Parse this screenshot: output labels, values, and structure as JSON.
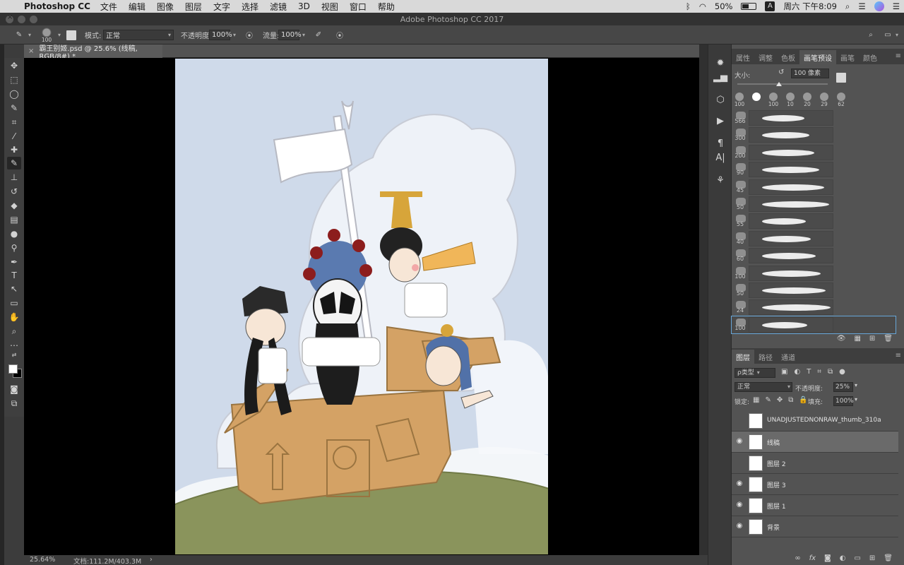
{
  "menubar": {
    "app": "Photoshop CC",
    "items": [
      "文件",
      "编辑",
      "图像",
      "图层",
      "文字",
      "选择",
      "滤镜",
      "3D",
      "视图",
      "窗口",
      "帮助"
    ],
    "battery": "50%",
    "input_source": "A",
    "clock": "周六 下午8:09"
  },
  "window": {
    "title": "Adobe Photoshop CC 2017"
  },
  "options_bar": {
    "brush_size": "100",
    "mode_label": "模式:",
    "mode_value": "正常",
    "opacity_label": "不透明度:",
    "opacity_value": "100%",
    "flow_label": "流量:",
    "flow_value": "100%"
  },
  "document_tab": {
    "title": "霸王别姬.psd @ 25.6% (线稿, RGB/8#) *"
  },
  "status_bar": {
    "zoom": "25.64%",
    "doc_size": "文档:111.2M/403.3M"
  },
  "brush_panel": {
    "tabs": [
      "属性",
      "调整",
      "色板",
      "画笔预设",
      "画笔",
      "颜色"
    ],
    "active_tab": "画笔预设",
    "size_label": "大小:",
    "size_value": "100 像素",
    "slider_fraction": 0.46,
    "top_presets": [
      "100",
      "",
      "100",
      "10",
      "20",
      "29",
      "62"
    ],
    "presets": [
      "566",
      "300",
      "200",
      "90",
      "45",
      "50",
      "55",
      "40",
      "60",
      "100",
      "50",
      "24",
      "100"
    ],
    "selected_index": 12
  },
  "layers_panel": {
    "tabs": [
      "图层",
      "路径",
      "通道"
    ],
    "active_tab": "图层",
    "filter_label": "ρ类型",
    "blend_mode": "正常",
    "opacity_label": "不透明度:",
    "opacity_value": "25%",
    "lock_label": "锁定:",
    "fill_label": "填充:",
    "fill_value": "100%",
    "layers": [
      {
        "name": "UNADJUSTEDNONRAW_thumb_310a",
        "visible": false,
        "selected": false
      },
      {
        "name": "线稿",
        "visible": true,
        "selected": true
      },
      {
        "name": "图层 2",
        "visible": false,
        "selected": false
      },
      {
        "name": "图层 3",
        "visible": true,
        "selected": false
      },
      {
        "name": "图层 1",
        "visible": true,
        "selected": false
      },
      {
        "name": "背景",
        "visible": true,
        "selected": false
      }
    ]
  },
  "colors": {
    "sky": "#cfdaea",
    "ground": "#8a945c",
    "box": "#d4a265",
    "accent_selection": "#67a6d8"
  }
}
